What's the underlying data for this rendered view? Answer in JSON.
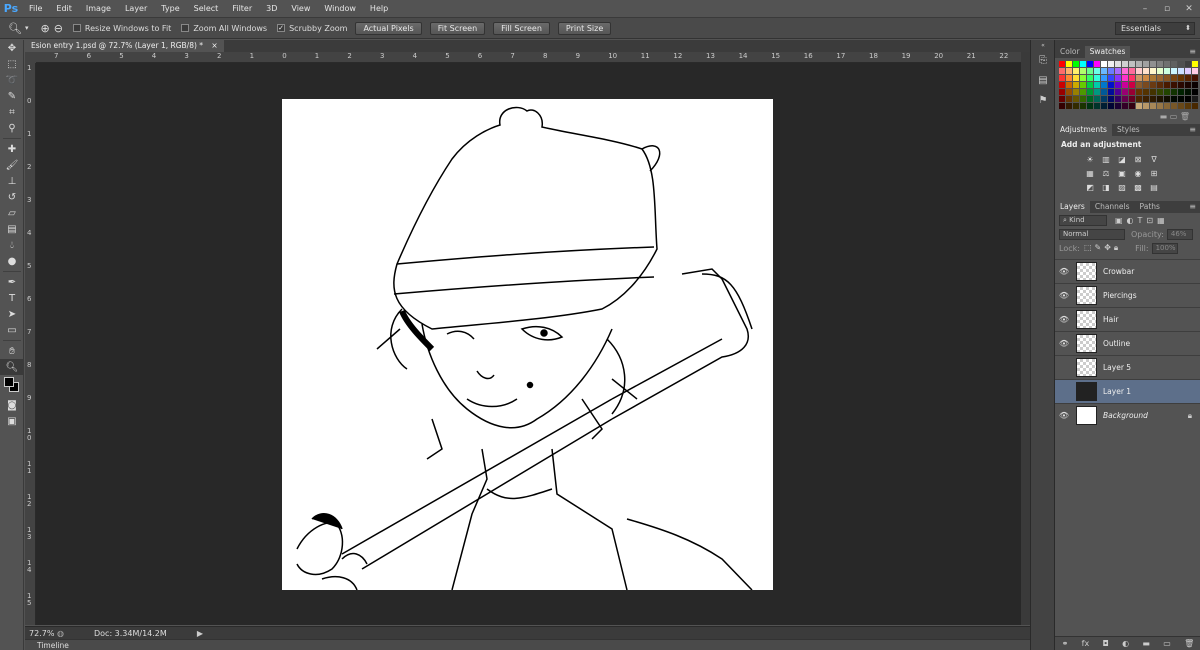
{
  "app": {
    "logo": "Ps"
  },
  "menu": [
    "File",
    "Edit",
    "Image",
    "Layer",
    "Type",
    "Select",
    "Filter",
    "3D",
    "View",
    "Window",
    "Help"
  ],
  "window_controls": [
    "–",
    "▫",
    "✕"
  ],
  "options_bar": {
    "checkboxes": [
      {
        "label": "Resize Windows to Fit",
        "checked": false
      },
      {
        "label": "Zoom All Windows",
        "checked": false
      },
      {
        "label": "Scrubby Zoom",
        "checked": true
      }
    ],
    "buttons": [
      "Actual Pixels",
      "Fit Screen",
      "Fill Screen",
      "Print Size"
    ],
    "workspace": "Essentials"
  },
  "document": {
    "tab_title": "Esion entry 1.psd @ 72.7% (Layer 1, RGB/8) *",
    "close": "×",
    "ruler_top": [
      "7",
      "6",
      "5",
      "4",
      "3",
      "2",
      "1",
      "0",
      "1",
      "2",
      "3",
      "4",
      "5",
      "6",
      "7",
      "8",
      "9",
      "10",
      "11",
      "12",
      "13",
      "14",
      "15",
      "16",
      "17",
      "18",
      "19",
      "20",
      "21",
      "22"
    ],
    "ruler_left": [
      "1",
      "0",
      "1",
      "2",
      "3",
      "4",
      "5",
      "6",
      "7",
      "8",
      "9",
      "1 0",
      "1 1",
      "1 2",
      "1 3",
      "1 4",
      "1 5"
    ]
  },
  "status": {
    "zoom": "72.7%",
    "doc": "Doc: 3.34M/14.2M"
  },
  "timeline": {
    "label": "Timeline"
  },
  "swatches_panel": {
    "tabs": [
      "Color",
      "Swatches"
    ],
    "colors": [
      "#ff0000",
      "#ffff00",
      "#00ff00",
      "#00ffff",
      "#0000ff",
      "#ff00ff",
      "#ffffff",
      "#f0f0f0",
      "#e0e0e0",
      "#d0d0d0",
      "#c0c0c0",
      "#b0b0b0",
      "#a0a0a0",
      "#909090",
      "#808080",
      "#707070",
      "#606060",
      "#505050",
      "#404040",
      "#ffff00",
      "#ff6b6b",
      "#ffb06b",
      "#fff06b",
      "#b0ff6b",
      "#6bff8e",
      "#6bffe8",
      "#6bb8ff",
      "#6b7bff",
      "#a66bff",
      "#ff6bd6",
      "#ff6b9b",
      "#ffcccc",
      "#ffe0cc",
      "#fff6cc",
      "#e6ffcc",
      "#ccffe0",
      "#ccf6ff",
      "#cce0ff",
      "#e0ccff",
      "#ffcce6",
      "#ff3333",
      "#ff8833",
      "#ffdd33",
      "#88ff33",
      "#33ff66",
      "#33ffdd",
      "#3399ff",
      "#3344ff",
      "#8833ff",
      "#ff33cc",
      "#ff3366",
      "#cc9966",
      "#cc8844",
      "#aa7733",
      "#996633",
      "#885522",
      "#774411",
      "#663300",
      "#552200",
      "#441100",
      "#cc0000",
      "#cc6600",
      "#ccaa00",
      "#66cc00",
      "#00cc44",
      "#00ccaa",
      "#0077cc",
      "#0011cc",
      "#6600cc",
      "#cc0099",
      "#cc0044",
      "#8b5a2b",
      "#7a4a1f",
      "#6a3a12",
      "#5a2a08",
      "#4a1a00",
      "#3a1000",
      "#2a0800",
      "#1a0400",
      "#0a0000",
      "#990000",
      "#994d00",
      "#998000",
      "#4d9900",
      "#009933",
      "#009980",
      "#005999",
      "#000d99",
      "#4d0099",
      "#990073",
      "#990033",
      "#663300",
      "#553300",
      "#443300",
      "#334400",
      "#224400",
      "#113300",
      "#002200",
      "#001100",
      "#000000",
      "#660000",
      "#663300",
      "#665500",
      "#336600",
      "#006622",
      "#006655",
      "#003b66",
      "#000966",
      "#330066",
      "#66004d",
      "#660022",
      "#4d2600",
      "#3d2000",
      "#2e1a00",
      "#1f1300",
      "#100d00",
      "#000800",
      "#000400",
      "#000000",
      "#1a1a1a",
      "#330000",
      "#331a00",
      "#332b00",
      "#1a3300",
      "#003311",
      "#00332b",
      "#001e33",
      "#000433",
      "#1a0033",
      "#330026",
      "#330011",
      "#c8a878",
      "#b89868",
      "#a88858",
      "#987848",
      "#886838",
      "#785828",
      "#684818",
      "#583808",
      "#482800"
    ]
  },
  "adjustments_panel": {
    "tabs": [
      "Adjustments",
      "Styles"
    ],
    "title": "Add an adjustment",
    "row1": [
      "☀",
      "▥",
      "◪",
      "⊠",
      "∇"
    ],
    "row2": [
      "▦",
      "⚖",
      "▣",
      "◉",
      "⊞"
    ],
    "row3": [
      "◩",
      "◨",
      "▨",
      "▩",
      "▤"
    ]
  },
  "layers_panel": {
    "tabs": [
      "Layers",
      "Channels",
      "Paths"
    ],
    "kind": "Kind",
    "blend": "Normal",
    "opacity_label": "Opacity:",
    "opacity_value": "46%",
    "lock_label": "Lock:",
    "fill_label": "Fill:",
    "fill_value": "100%",
    "layers": [
      {
        "name": "Crowbar",
        "visible": true,
        "thumb": "transparent"
      },
      {
        "name": "Piercings",
        "visible": true,
        "thumb": "transparent"
      },
      {
        "name": "Hair",
        "visible": true,
        "thumb": "transparent"
      },
      {
        "name": "Outline",
        "visible": true,
        "thumb": "transparent"
      },
      {
        "name": "Layer 5",
        "visible": false,
        "thumb": "transparent"
      },
      {
        "name": "Layer 1",
        "visible": false,
        "thumb": "dark",
        "selected": true
      },
      {
        "name": "Background",
        "visible": true,
        "thumb": "white",
        "locked": true
      }
    ],
    "footer_icons": [
      "⚭",
      "fx",
      "◘",
      "◐",
      "▬",
      "▭",
      "🗑"
    ]
  }
}
